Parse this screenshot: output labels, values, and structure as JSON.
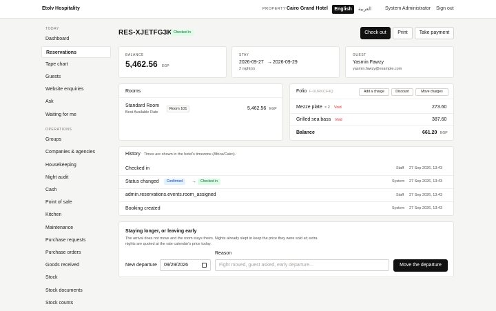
{
  "topbar": {
    "brand": "Etolv Hospitality",
    "property_label": "PROPERTY",
    "property_name": "Cairo Grand Hotel",
    "lang_en": "English",
    "lang_ar": "العربية",
    "user": "System Administrator",
    "sign_out": "Sign out"
  },
  "sidebar": {
    "today_heading": "TODAY",
    "today_items": [
      "Dashboard",
      "Reservations",
      "Tape chart",
      "Guests",
      "Website enquiries",
      "Ask",
      "Waiting for me"
    ],
    "operations_heading": "OPERATIONS",
    "operations_items": [
      "Groups",
      "Companies & agencies",
      "Housekeeping",
      "Night audit",
      "Cash",
      "Point of sale",
      "Kitchen",
      "Maintenance",
      "Purchase requests",
      "Purchase orders",
      "Goods received",
      "Stock",
      "Stock documents",
      "Stock counts"
    ],
    "active": "Reservations"
  },
  "header": {
    "reservation_code": "RES-XJETFG3K",
    "status": "Checked in",
    "check_out": "Check out",
    "print": "Print",
    "take_payment": "Take payment"
  },
  "balance_card": {
    "label": "BALANCE",
    "amount": "5,462.56",
    "currency": "EGP"
  },
  "stay_card": {
    "label": "STAY",
    "arrival": "2026-09-27",
    "arrow": "→",
    "departure": "2026-09-29",
    "nights": "2 night(s)"
  },
  "guest_card": {
    "label": "GUEST",
    "name": "Yasmin Fawzy",
    "email": "yasmin.fawzy@example.com"
  },
  "rooms_card": {
    "title": "Rooms",
    "room_type": "Standard Room",
    "rate": "Best Available Rate",
    "room": "Room 101",
    "amount": "5,462.56",
    "currency": "EGP"
  },
  "folio_card": {
    "title": "Folio",
    "folio_id": "F-0URKCF4Q",
    "add_charge": "Add a charge",
    "discount": "Discount",
    "move_charges": "Move charges",
    "lines": [
      {
        "item": "Mezze plate",
        "qty": "× 2",
        "status": "Void",
        "amount": "273.60"
      },
      {
        "item": "Grilled sea bass",
        "qty": "",
        "status": "Void",
        "amount": "387.60"
      }
    ],
    "balance_label": "Balance",
    "balance_amount": "661.20",
    "balance_currency": "EGP"
  },
  "history": {
    "title": "History",
    "note": "Times are shown in the hotel's timezone (Africa/Cairo).",
    "events": [
      {
        "text": "Checked in",
        "actor": "Staff",
        "time": "27 Sep 2026, 13:43"
      },
      {
        "text": "Status changed",
        "from": "Confirmed",
        "arrow": "→",
        "to": "Checked in",
        "actor": "System",
        "time": "27 Sep 2026, 13:43"
      },
      {
        "text": "admin.reservations.events.room_assigned",
        "actor": "Staff",
        "time": "27 Sep 2026, 13:43"
      },
      {
        "text": "Booking created",
        "actor": "System",
        "time": "27 Sep 2026, 13:43"
      }
    ]
  },
  "stay_change": {
    "title": "Staying longer, or leaving early",
    "desc_line1": "The arrival does not move and the room stays theirs. Nights already slept in keep the price they were sold at; extra",
    "desc_line2": "nights are quoted at the rate calendar's price today.",
    "departure_label": "New departure",
    "departure_value": "09/29/2026",
    "reason_label": "Reason",
    "reason_placeholder": "Fight moved, guest asked, early departure...",
    "submit": "Move the departure"
  },
  "colors": {
    "accent": "#111111",
    "void": "#dc2626",
    "success_bg": "#dcfce7",
    "info_bg": "#e0f2fe"
  }
}
